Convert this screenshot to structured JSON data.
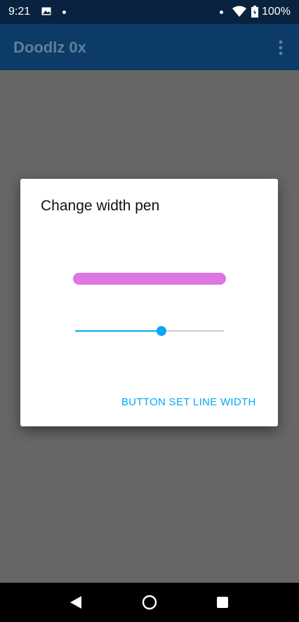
{
  "status_bar": {
    "time": "9:21",
    "battery": "100%",
    "icons": [
      "image-icon",
      "dot-icon",
      "dot-icon",
      "wifi-icon",
      "battery-icon"
    ]
  },
  "app_bar": {
    "title": "Doodlz 0x",
    "overflow_icon": "more-vert-icon"
  },
  "dialog": {
    "title": "Change width pen",
    "preview_color": "#dd75e3",
    "slider_value_fraction": 0.58,
    "button_label": "BUTTON SET LINE WIDTH"
  },
  "colors": {
    "accent": "#03a9f4",
    "app_bar": "#0b3b66",
    "status_bar": "#08223f",
    "scrim": "#666666"
  },
  "nav_bar": {
    "icons": [
      "back-icon",
      "home-icon",
      "recents-icon"
    ]
  }
}
